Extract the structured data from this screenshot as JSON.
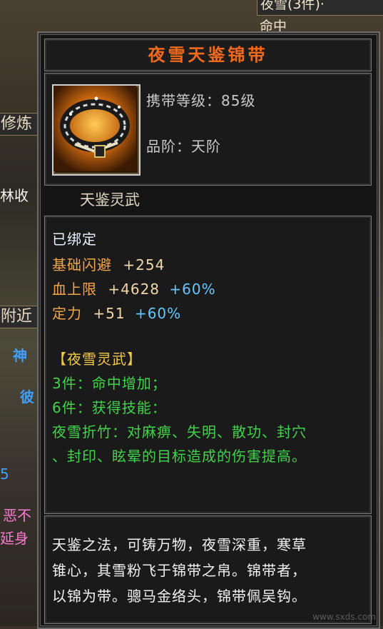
{
  "background": {
    "top_right_tab": "夜雪(3件)·",
    "top_right_sub": "命中",
    "left_tabs": [
      "修炼",
      "林收",
      "附近"
    ],
    "left_labels": [
      "神",
      "彼",
      "5",
      "恶不",
      "延身"
    ]
  },
  "item": {
    "name": "夜雪天鉴锦带",
    "icon_name": "belt-item-icon",
    "level_req": "携带等级：85级",
    "grade": "品阶：天阶",
    "set_label": "天鉴灵武"
  },
  "stats": {
    "bound": "已绑定",
    "dodge_label": "基础闪避",
    "dodge_value": "+254",
    "hp_label": "血上限",
    "hp_value": "+4628",
    "hp_pct": "+60%",
    "focus_label": "定力",
    "focus_value": "+51",
    "focus_pct": "+60%"
  },
  "set_bonus": {
    "title": "【夜雪灵武】",
    "bonus_3": "3件：命中增加；",
    "bonus_6": "6件：获得技能：",
    "skill_line1": "夜雪折竹：对麻痹、失明、散功、封穴",
    "skill_line2": "、封印、眩晕的目标造成的伤害提高。"
  },
  "description": [
    "天鉴之法，可铸万物，夜雪深重，寒草",
    "锥心，其雪粉飞于锦带之帛。锦带者，",
    "以锦为带。骢马金络头，锦带佩吴钩。"
  ],
  "watermark": "www.sxds.com",
  "colors": {
    "title": "#f36a1e",
    "bound": "#e8f2ff",
    "stat_label": "#f5a64a",
    "stat_value": "#f2d7a8",
    "stat_pct": "#67c7ff",
    "set_title": "#f5c84a",
    "set_text": "#41d44a"
  }
}
